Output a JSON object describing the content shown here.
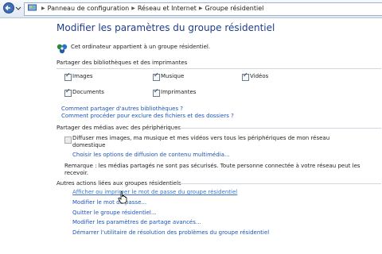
{
  "breadcrumb": {
    "items": [
      "Panneau de configuration",
      "Réseau et Internet",
      "Groupe résidentiel"
    ]
  },
  "page": {
    "title": "Modifier les paramètres du groupe résidentiel",
    "owner_text": "Cet ordinateur appartient à un groupe résidentiel."
  },
  "libraries": {
    "heading": "Partager des bibliothèques et des imprimantes",
    "items": [
      {
        "label": "Images",
        "checked": true
      },
      {
        "label": "Musique",
        "checked": true
      },
      {
        "label": "Vidéos",
        "checked": true
      },
      {
        "label": "Documents",
        "checked": true
      },
      {
        "label": "Imprimantes",
        "checked": true
      }
    ],
    "link_other": "Comment partager d'autres bibliothèques ?",
    "link_exclude": "Comment procéder pour exclure des fichiers et des dossiers ?"
  },
  "media": {
    "heading": "Partager des médias avec des périphériques",
    "stream_line1": "Diffuser mes images, ma musique et mes vidéos vers tous les périphériques de mon réseau",
    "stream_line2": "domestique",
    "stream_checked": false,
    "link_options": "Choisir les options de diffusion de contenu multimédia...",
    "remark_line1": "Remarque : les médias partagés ne sont pas sécurisés. Toute personne connectée à votre réseau peut les",
    "remark_line2": "recevoir."
  },
  "actions": {
    "heading": "Autres actions liées aux groupes résidentiels",
    "links": [
      "Afficher ou imprimer le mot de passe du groupe résidentiel",
      "Modifier le mot de passe...",
      "Quitter le groupe résidentiel...",
      "Modifier les paramètres de partage avancés...",
      "Démarrer l'utilitaire de résolution des problèmes du groupe résidentiel"
    ]
  },
  "colors": {
    "title": "#1f3d8a",
    "link": "#1d56b8",
    "hovered_link": "#3a74c8"
  }
}
